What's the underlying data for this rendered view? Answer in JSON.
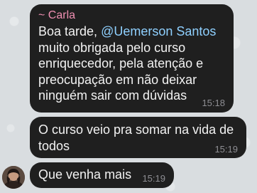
{
  "messages": [
    {
      "sender": "~ Carla",
      "lines": [
        {
          "text": "Boa tarde, ",
          "mention": "@Uemerson Santos"
        },
        "muito obrigada pelo curso",
        "enriquecedor, pela atenção e",
        "preocupação em não deixar",
        "ninguém sair com dúvidas"
      ],
      "time": "15:18"
    },
    {
      "lines": [
        "O curso veio pra somar na vida de",
        "todos"
      ],
      "time": "15:19"
    },
    {
      "lines": [
        "Que venha mais"
      ],
      "time": "15:19"
    }
  ],
  "colors": {
    "bubble": "#1f1f1f",
    "sender_name": "#ef8fb2",
    "mention": "#8fd0ff",
    "timestamp": "#8e8e93"
  },
  "icons": [
    "sender-avatar"
  ]
}
